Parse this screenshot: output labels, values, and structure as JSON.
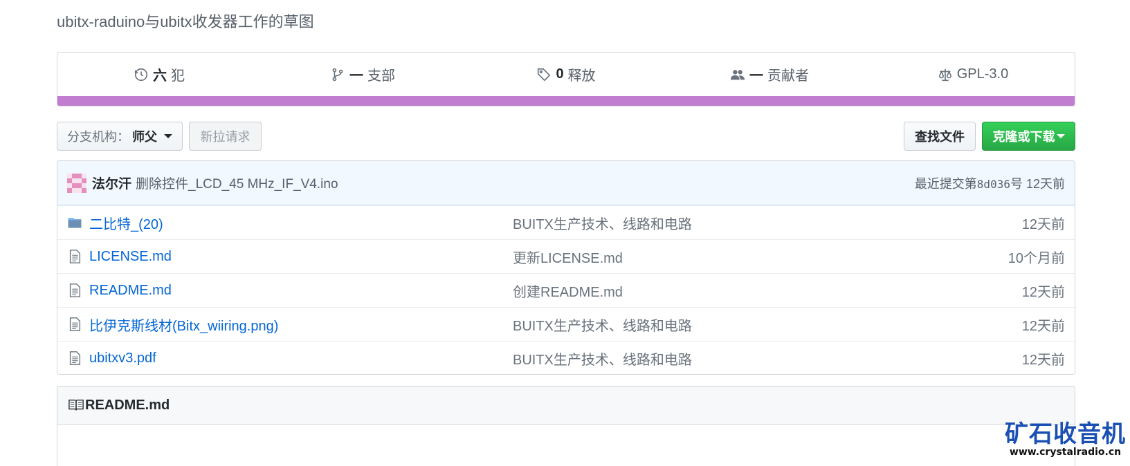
{
  "repo": {
    "description": "ubitx-raduino与ubitx收发器工作的草图"
  },
  "summary": {
    "commits": {
      "count": "六",
      "label": "犯"
    },
    "branches": {
      "count": "一",
      "label": "支部"
    },
    "releases": {
      "count": "0",
      "label": "释放"
    },
    "contributors": {
      "count": "一",
      "label": "贡献者"
    },
    "license": {
      "label": "GPL-3.0"
    },
    "language_color": "#c17ed0"
  },
  "toolbar": {
    "branch_prefix": "分支机构：",
    "branch_name": "师父",
    "new_pr_label": "新拉请求",
    "find_file_label": "查找文件",
    "clone_label": "克隆或下载"
  },
  "commit": {
    "author": "法尔汗",
    "message": "删除控件_LCD_45 MHz_IF_V4.ino",
    "meta_prefix": "最近提交第",
    "sha": "8d036",
    "meta_suffix": "号 12天前"
  },
  "files": [
    {
      "type": "folder",
      "name": "二比特_(20)",
      "message": "BUITX生产技术、线路和电路",
      "age": "12天前"
    },
    {
      "type": "file",
      "name": "LICENSE.md",
      "message": "更新LICENSE.md",
      "age": "10个月前"
    },
    {
      "type": "file",
      "name": "README.md",
      "message": "创建README.md",
      "age": "12天前"
    },
    {
      "type": "file",
      "name": "比伊克斯线材(Bitx_wiiring.png)",
      "message": "BUITX生产技术、线路和电路",
      "age": "12天前"
    },
    {
      "type": "file",
      "name": "ubitxv3.pdf",
      "message": "BUITX生产技术、线路和电路",
      "age": "12天前"
    }
  ],
  "readme": {
    "title": "README.md"
  },
  "watermark": {
    "title": "矿石收音机",
    "url": "www.crystalradio.cn"
  },
  "colors": {
    "link": "#0366d6",
    "clone_button": "#28a745",
    "commit_bar": "#f1f8ff"
  }
}
